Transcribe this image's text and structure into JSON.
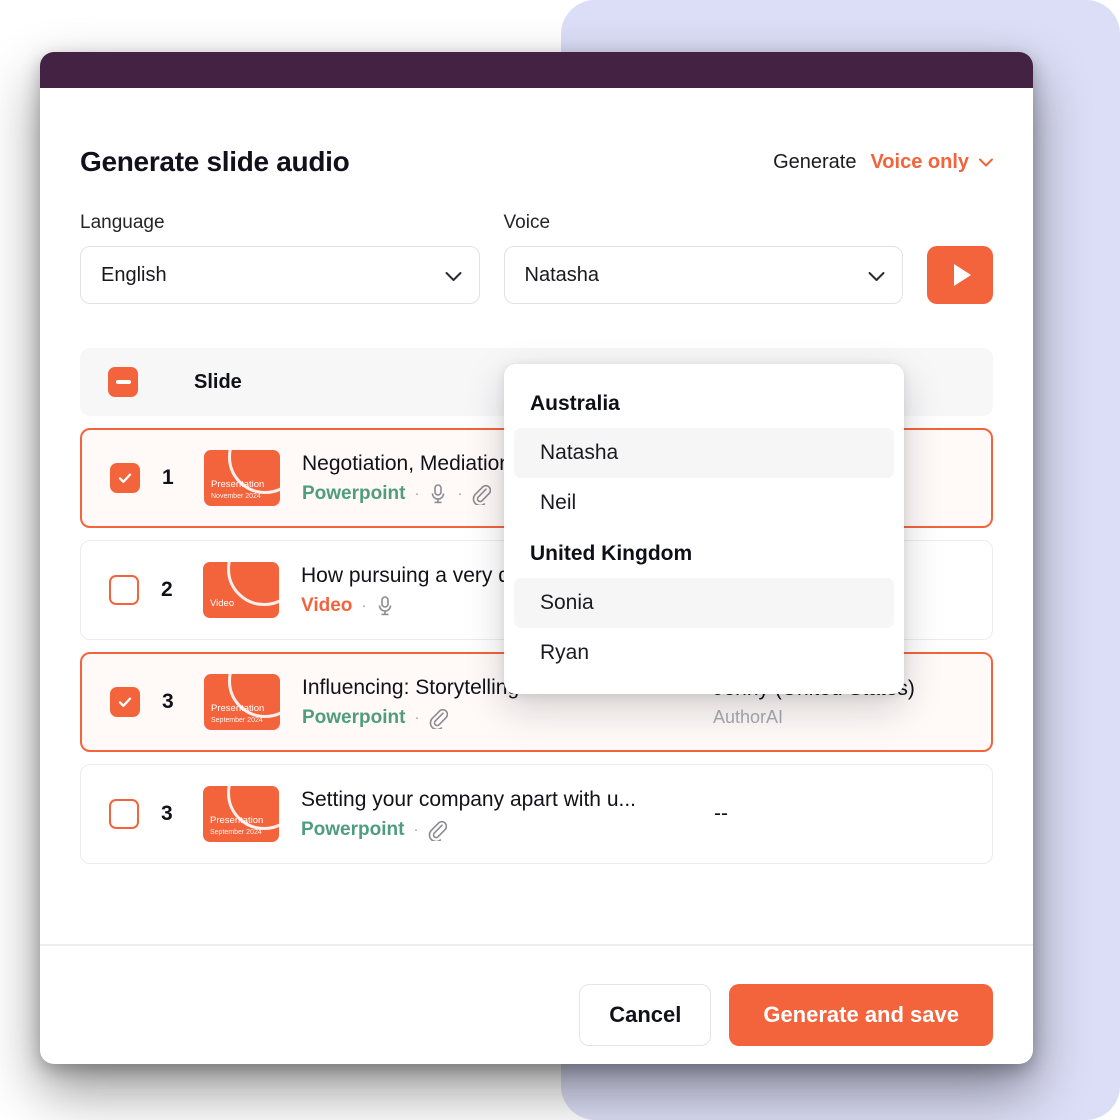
{
  "header": {
    "title": "Generate slide audio",
    "generate_label": "Generate",
    "mode_value": "Voice only",
    "mode_icon": "chevron-down-icon"
  },
  "fields": {
    "language": {
      "label": "Language",
      "value": "English",
      "icon": "chevron-down-icon"
    },
    "voice": {
      "label": "Voice",
      "value": "Natasha",
      "icon": "chevron-down-icon"
    },
    "preview": {
      "icon": "play-icon"
    }
  },
  "voice_dropdown": {
    "open": true,
    "groups": [
      {
        "label": "Australia",
        "options": [
          {
            "label": "Natasha",
            "highlighted": true
          },
          {
            "label": "Neil",
            "highlighted": false
          }
        ]
      },
      {
        "label": "United Kingdom",
        "options": [
          {
            "label": "Sonia",
            "highlighted": true
          },
          {
            "label": "Ryan",
            "highlighted": false
          }
        ]
      }
    ]
  },
  "table": {
    "select_all_state": "indeterminate",
    "columns": {
      "slide": "Slide"
    },
    "rows": [
      {
        "checked": true,
        "number": "1",
        "thumb": {
          "kind": "Presentation",
          "date": "November 2024"
        },
        "title": "Negotiation, Mediation and Conflict Resolution with Brian",
        "type": "Powerpoint",
        "type_style": "powerpoint",
        "icons": [
          "microphone-icon",
          "paperclip-icon"
        ],
        "right_main": "",
        "right_sub": ""
      },
      {
        "checked": false,
        "number": "2",
        "thumb": {
          "kind": "Video",
          "date": ""
        },
        "title": "How pursuing a very different career",
        "type": "Video",
        "type_style": "video",
        "icons": [
          "microphone-icon"
        ],
        "right_main": "",
        "right_sub": ""
      },
      {
        "checked": true,
        "number": "3",
        "thumb": {
          "kind": "Presentation",
          "date": "September 2024"
        },
        "title": "Influencing: Storytelling",
        "type": "Powerpoint",
        "type_style": "powerpoint",
        "icons": [
          "paperclip-icon"
        ],
        "right_main": "Jenny (United States)",
        "right_sub": "AuthorAI"
      },
      {
        "checked": false,
        "number": "3",
        "thumb": {
          "kind": "Presentation",
          "date": "September 2024"
        },
        "title": "Setting your company apart with u...",
        "type": "Powerpoint",
        "type_style": "powerpoint",
        "icons": [
          "paperclip-icon"
        ],
        "right_main": "--",
        "right_sub": ""
      }
    ]
  },
  "footer": {
    "cancel_label": "Cancel",
    "primary_label": "Generate and save"
  },
  "colors": {
    "accent": "#f4643c",
    "topbar": "#432244",
    "backdrop": "#dcdef7",
    "powerpoint": "#4f9c7f"
  }
}
